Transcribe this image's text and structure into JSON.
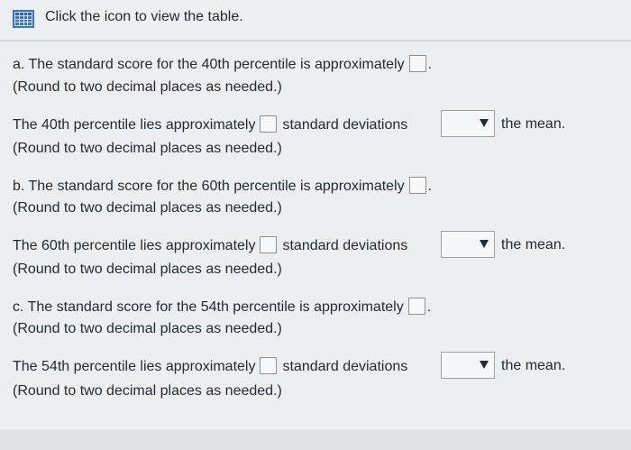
{
  "header": {
    "instruction": "Click the icon to view the table."
  },
  "questions": [
    {
      "score_prefix": "a. The standard score for the 40th percentile is approximately",
      "score_period": ".",
      "score_round": "(Round to two decimal places as needed.)",
      "lies_prefix": "The 40th percentile lies approximately",
      "lies_middle": "standard deviations",
      "lies_suffix": "the mean.",
      "lies_round": "(Round to two decimal places as needed.)"
    },
    {
      "score_prefix": "b. The standard score for the 60th percentile is approximately",
      "score_period": ".",
      "score_round": "(Round to two decimal places as needed.)",
      "lies_prefix": "The 60th percentile lies approximately",
      "lies_middle": "standard deviations",
      "lies_suffix": "the mean.",
      "lies_round": "(Round to two decimal places as needed.)"
    },
    {
      "score_prefix": "c. The standard score for the 54th percentile is approximately",
      "score_period": ".",
      "score_round": "(Round to two decimal places as needed.)",
      "lies_prefix": "The 54th percentile lies approximately",
      "lies_middle": "standard deviations",
      "lies_suffix": "the mean.",
      "lies_round": "(Round to two decimal places as needed.)"
    }
  ]
}
